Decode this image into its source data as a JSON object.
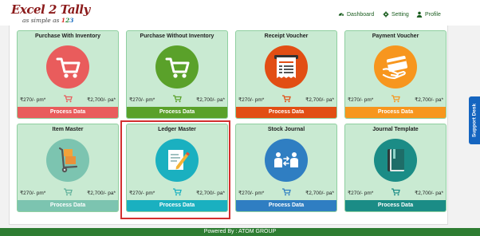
{
  "header": {
    "logo_main": "Excel 2 Tally",
    "logo_tag_prefix": "as simple as",
    "logo_tag_d1": "1",
    "logo_tag_d2": "2",
    "logo_tag_d3": "3",
    "nav": [
      {
        "label": "Dashboard",
        "icon": "dashboard-icon"
      },
      {
        "label": "Setting",
        "icon": "gear-icon"
      },
      {
        "label": "Profile",
        "icon": "user-icon"
      }
    ]
  },
  "cards": [
    {
      "title": "Purchase With Inventory",
      "price_pm": "₹270/- pm*",
      "price_pa": "₹2,700/- pa*",
      "button": "Process Data",
      "color": "#e95c5c",
      "icon": "cart-icon"
    },
    {
      "title": "Purchase Without Inventory",
      "price_pm": "₹270/- pm*",
      "price_pa": "₹2,700/- pa*",
      "button": "Process Data",
      "color": "#5aa12a",
      "icon": "cart-icon"
    },
    {
      "title": "Receipt Voucher",
      "price_pm": "₹270/- pm*",
      "price_pa": "₹2,700/- pa*",
      "button": "Process Data",
      "color": "#e24e14",
      "icon": "receipt-icon"
    },
    {
      "title": "Payment Voucher",
      "price_pm": "₹270/- pm*",
      "price_pa": "₹2,700/- pa*",
      "button": "Process Data",
      "color": "#f7961e",
      "icon": "credit-card-icon"
    },
    {
      "title": "Item Master",
      "price_pm": "₹270/- pm*",
      "price_pa": "₹2,700/- pa*",
      "button": "Process Data",
      "color": "#7cc4b0",
      "icon": "hand-truck-icon"
    },
    {
      "title": "Ledger Master",
      "price_pm": "₹270/- pm*",
      "price_pa": "₹2,700/- pa*",
      "button": "Process Data",
      "color": "#1ab0c0",
      "icon": "document-edit-icon"
    },
    {
      "title": "Stock Journal",
      "price_pm": "₹270/- pm*",
      "price_pa": "₹2,700/- pa*",
      "button": "Process Data",
      "color": "#2f7ec2",
      "icon": "transfer-users-icon"
    },
    {
      "title": "Journal Template",
      "price_pm": "₹270/- pm*",
      "price_pa": "₹2,700/- pa*",
      "button": "Process Data",
      "color": "#1b8c86",
      "icon": "book-icon"
    }
  ],
  "support_tab": "Support Desk",
  "footer": "Powered By : ATOM GROUP",
  "colors": {
    "accent": "#2e7d32",
    "card_bg": "#c9ead2",
    "highlight": "#d32f2f",
    "support": "#1565c0"
  }
}
